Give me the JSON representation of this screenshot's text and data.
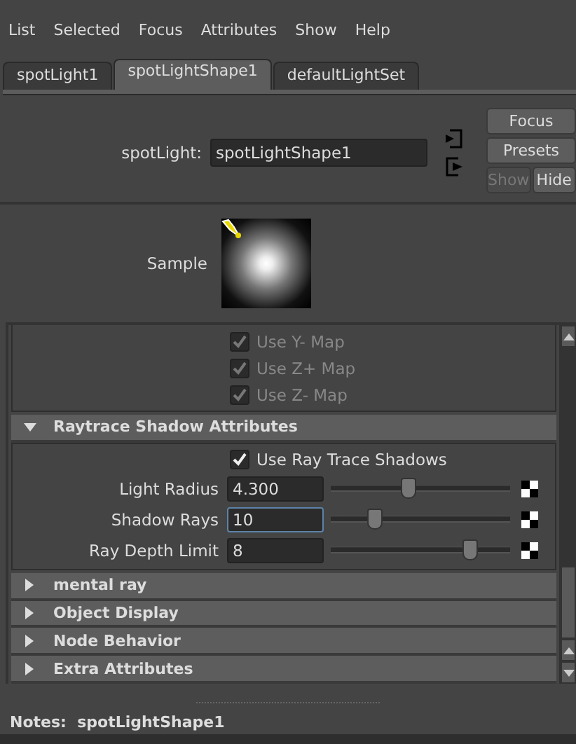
{
  "menu": [
    "List",
    "Selected",
    "Focus",
    "Attributes",
    "Show",
    "Help"
  ],
  "tabs": [
    {
      "label": "spotLight1",
      "selected": false
    },
    {
      "label": "spotLightShape1",
      "selected": true
    },
    {
      "label": "defaultLightSet",
      "selected": false
    }
  ],
  "node": {
    "label": "spotLight:",
    "value": "spotLightShape1"
  },
  "side_buttons": [
    {
      "label": "Focus",
      "disabled": false
    },
    {
      "label": "Presets",
      "disabled": false
    }
  ],
  "toggle_buttons": [
    {
      "label": "Show",
      "disabled": true
    },
    {
      "label": "Hide",
      "disabled": false
    }
  ],
  "sample": {
    "label": "Sample"
  },
  "partial_rows": [
    {
      "kind": "checkbox",
      "label": "Use Y- Map",
      "checked": true,
      "disabled": true
    },
    {
      "kind": "checkbox",
      "label": "Use Z+ Map",
      "checked": true,
      "disabled": true
    },
    {
      "kind": "checkbox",
      "label": "Use Z- Map",
      "checked": true,
      "disabled": true
    }
  ],
  "sections": [
    {
      "title": "Raytrace Shadow Attributes",
      "expanded": true,
      "rows": [
        {
          "kind": "checkbox",
          "label": "Use Ray Trace Shadows",
          "checked": true,
          "disabled": false
        },
        {
          "kind": "slider",
          "label": "Light Radius",
          "value": "4.300",
          "level": 0.43,
          "focused": false
        },
        {
          "kind": "slider",
          "label": "Shadow Rays",
          "value": "10",
          "level": 0.24,
          "focused": true
        },
        {
          "kind": "slider",
          "label": "Ray Depth Limit",
          "value": "8",
          "level": 0.77,
          "focused": false
        }
      ]
    },
    {
      "title": "mental ray",
      "expanded": false
    },
    {
      "title": "Object Display",
      "expanded": false
    },
    {
      "title": "Node Behavior",
      "expanded": false
    },
    {
      "title": "Extra Attributes",
      "expanded": false
    }
  ],
  "notes": {
    "label": "Notes:",
    "value": "spotLightShape1"
  }
}
